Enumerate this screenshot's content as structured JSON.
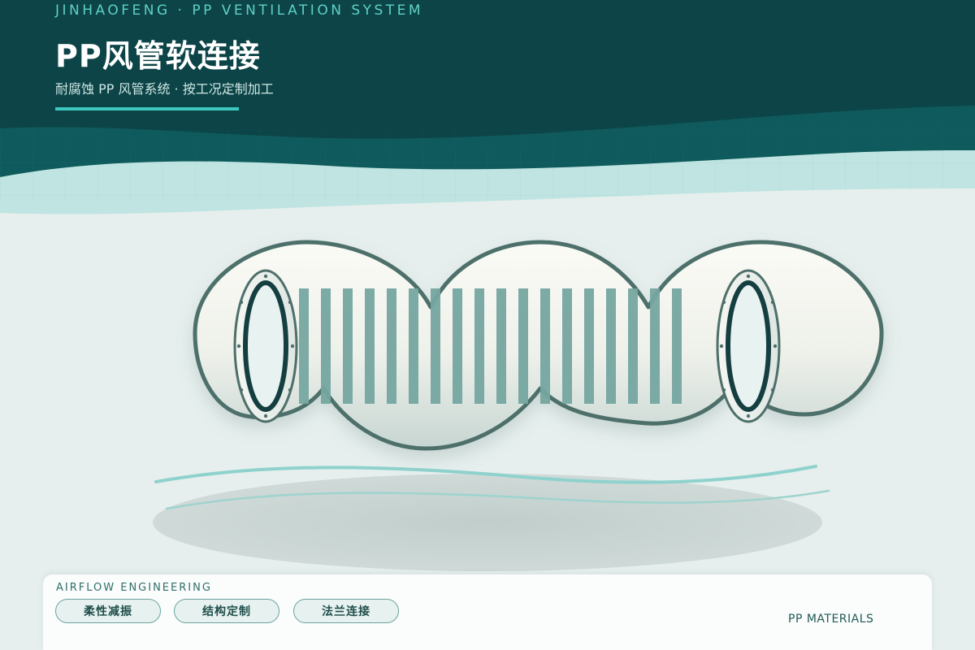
{
  "colors": {
    "header_dark": "#0c4448",
    "header_mid": "#0f5a5c",
    "accent_teal": "#3ec7bf",
    "wave_light": "#bfe4e1",
    "body_bg": "#e6efed",
    "outline": "#4e6f6a",
    "corrugation": "#76a6a0",
    "flange_dark": "#153e40"
  },
  "header": {
    "brand": "JINHAOFENG · PP VENTILATION SYSTEM",
    "title": "PP风管软连接",
    "subtitle": "耐腐蚀 PP 风管系统 · 按工况定制加工"
  },
  "illustration": {
    "subject": "flexible-duct-connector",
    "corrugation_ribs": 18
  },
  "footer": {
    "section_label": "AIRFLOW ENGINEERING",
    "tags": [
      "柔性减振",
      "结构定制",
      "法兰连接"
    ],
    "materials_label": "PP MATERIALS"
  }
}
